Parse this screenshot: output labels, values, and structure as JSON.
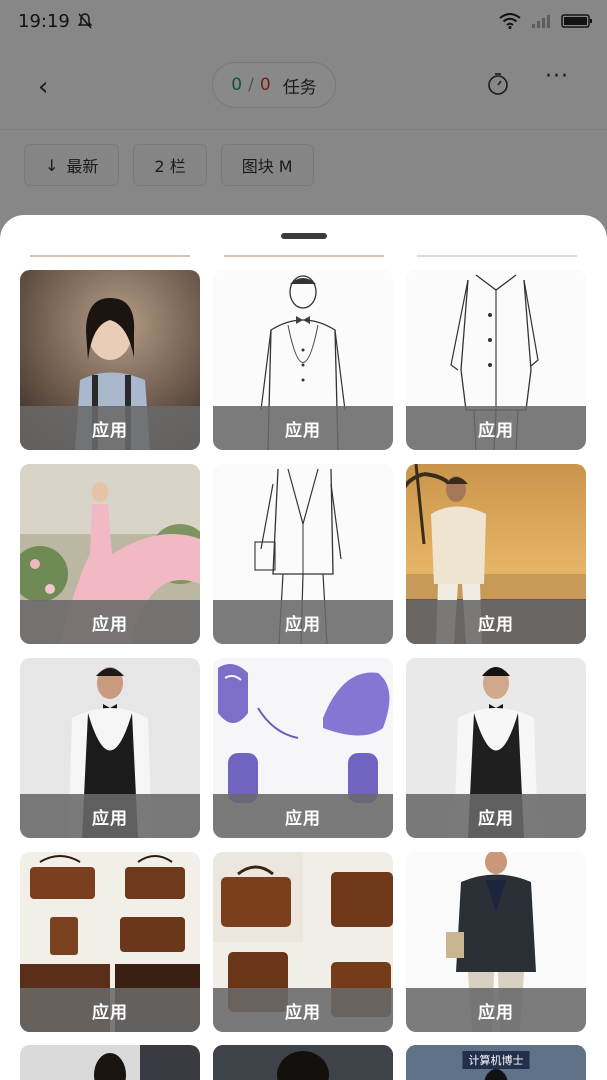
{
  "status": {
    "time": "19:19"
  },
  "header": {
    "task_done": "0",
    "task_sep": "/",
    "task_total": "0",
    "task_label": "任务"
  },
  "filters": [
    {
      "icon": "↓",
      "label": "最新"
    },
    {
      "label": "2 栏"
    },
    {
      "label": "图块 M"
    }
  ],
  "templates": [
    {
      "subject": "girl-in-suspenders-portrait",
      "apply_label": "应用"
    },
    {
      "subject": "man-bowtie-line-sketch",
      "apply_label": "应用"
    },
    {
      "subject": "jacket-outline-sketch",
      "apply_label": "应用"
    },
    {
      "subject": "woman-pink-gown-garden",
      "apply_label": "应用"
    },
    {
      "subject": "suit-outline-sketch",
      "apply_label": "应用"
    },
    {
      "subject": "man-beach-sunset",
      "apply_label": "应用"
    },
    {
      "subject": "man-black-vest-bowtie",
      "apply_label": "应用"
    },
    {
      "subject": "purple-bag-views",
      "apply_label": "应用"
    },
    {
      "subject": "man-black-vest-bowtie-2",
      "apply_label": "应用"
    },
    {
      "subject": "brown-leather-bags-grid",
      "apply_label": "应用"
    },
    {
      "subject": "brown-leather-briefcase-grid",
      "apply_label": "应用"
    },
    {
      "subject": "man-navy-blazer",
      "apply_label": "应用"
    }
  ],
  "partial_tiles": [
    {
      "subject": "man-bookshelf"
    },
    {
      "subject": "man-dark-hair"
    },
    {
      "subject": "man-computer-doctor",
      "caption": "计算机博士"
    }
  ],
  "colors": {
    "done": "#1f9d55",
    "total": "#d33333",
    "apply_overlay": "#696969"
  }
}
